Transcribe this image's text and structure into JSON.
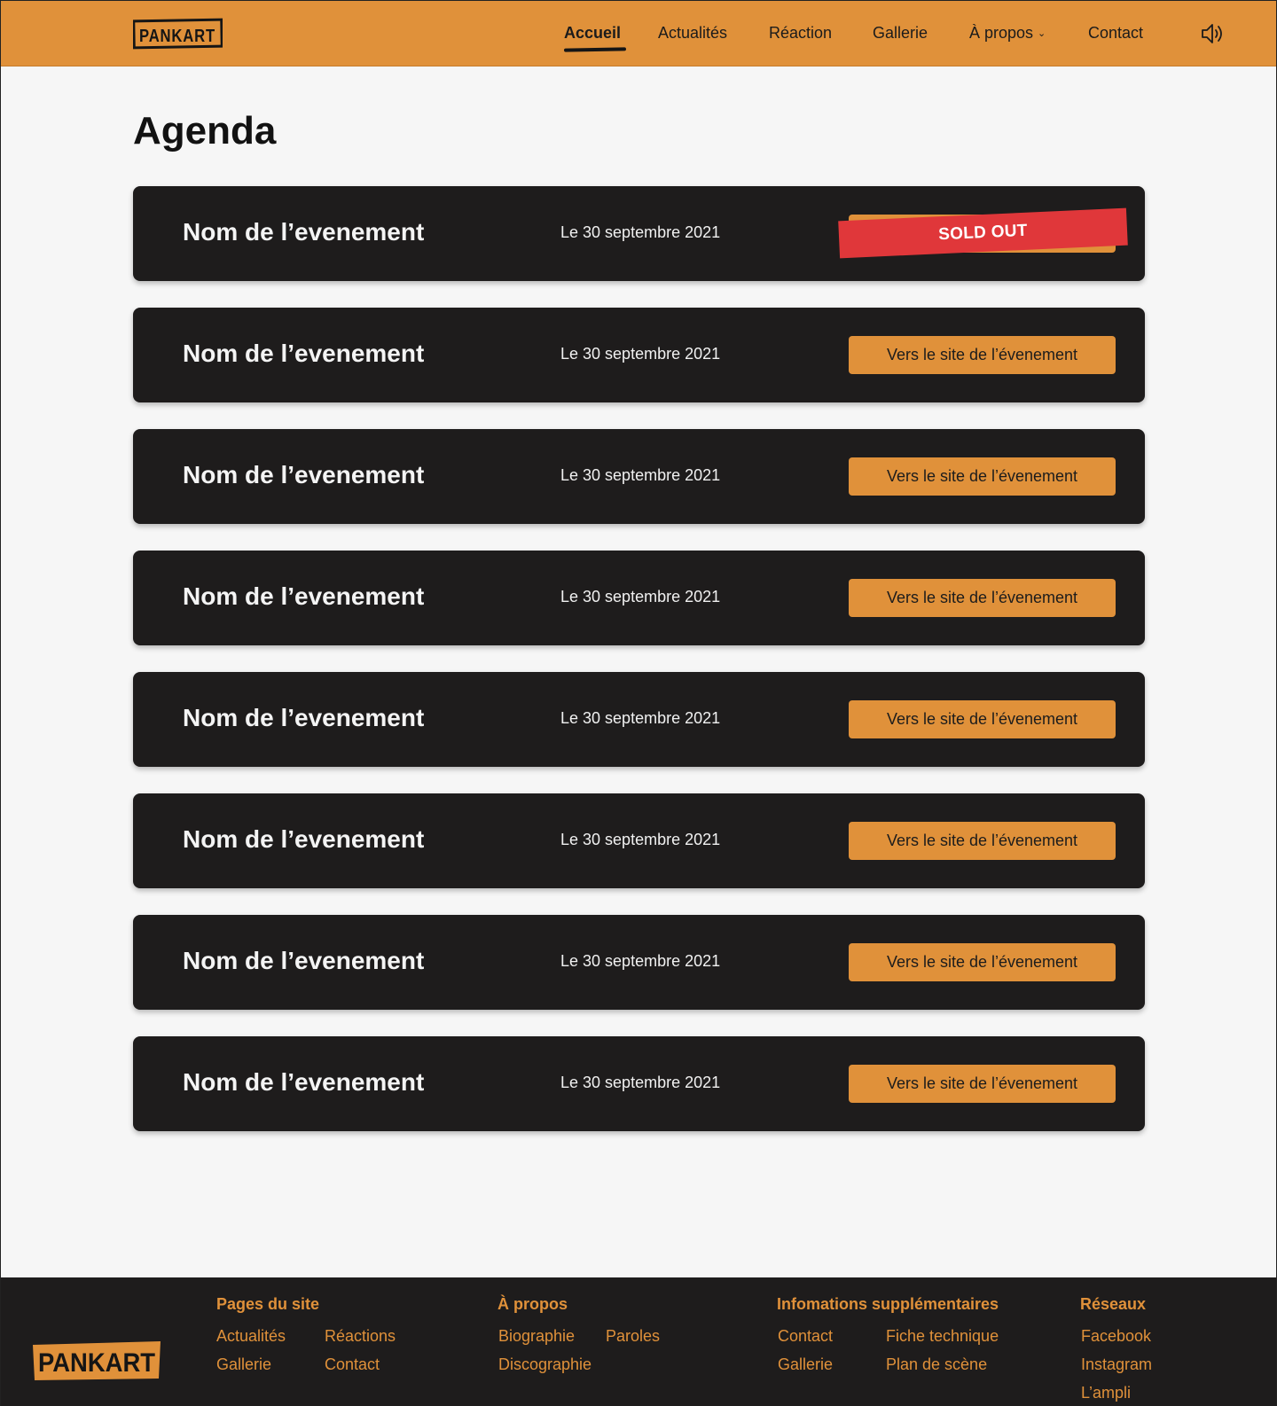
{
  "brand": {
    "logo_text": "PANKART",
    "accent_color": "#e0913a",
    "dark_color": "#1e1c1c",
    "soldout_color": "#e0373a"
  },
  "nav": {
    "items": [
      {
        "label": "Accueil",
        "active": true
      },
      {
        "label": "Actualités"
      },
      {
        "label": "Réaction"
      },
      {
        "label": "Gallerie"
      },
      {
        "label": "À propos",
        "has_dropdown": true,
        "dropdown_icon": "chevron-down-icon"
      },
      {
        "label": "Contact"
      }
    ],
    "sound_icon": "speaker-icon"
  },
  "main": {
    "title": "Agenda",
    "events": [
      {
        "name": "Nom de l’evenement",
        "date": "Le 30 septembre 2021",
        "status": "SOLD OUT"
      },
      {
        "name": "Nom de l’evenement",
        "date": "Le 30 septembre 2021",
        "button": "Vers le site de l’évenement"
      },
      {
        "name": "Nom de l’evenement",
        "date": "Le 30 septembre 2021",
        "button": "Vers le site de l’évenement"
      },
      {
        "name": "Nom de l’evenement",
        "date": "Le 30 septembre 2021",
        "button": "Vers le site de l’évenement"
      },
      {
        "name": "Nom de l’evenement",
        "date": "Le 30 septembre 2021",
        "button": "Vers le site de l’évenement"
      },
      {
        "name": "Nom de l’evenement",
        "date": "Le 30 septembre 2021",
        "button": "Vers le site de l’évenement"
      },
      {
        "name": "Nom de l’evenement",
        "date": "Le 30 septembre 2021",
        "button": "Vers le site de l’évenement"
      },
      {
        "name": "Nom de l’evenement",
        "date": "Le 30 septembre 2021",
        "button": "Vers le site de l’évenement"
      }
    ]
  },
  "footer": {
    "logo_text": "PANKART",
    "columns": [
      {
        "heading": "Pages du site",
        "links": [
          "Actualités",
          "Réactions",
          "Gallerie",
          "Contact"
        ]
      },
      {
        "heading": "À propos",
        "links": [
          "Biographie",
          "Paroles",
          "Discographie"
        ]
      },
      {
        "heading": "Infomations supplémentaires",
        "links": [
          "Contact",
          "Fiche technique",
          "Gallerie",
          "Plan de scène"
        ]
      },
      {
        "heading": "Réseaux",
        "links": [
          "Facebook",
          "Instagram",
          "L’ampli"
        ]
      }
    ]
  }
}
